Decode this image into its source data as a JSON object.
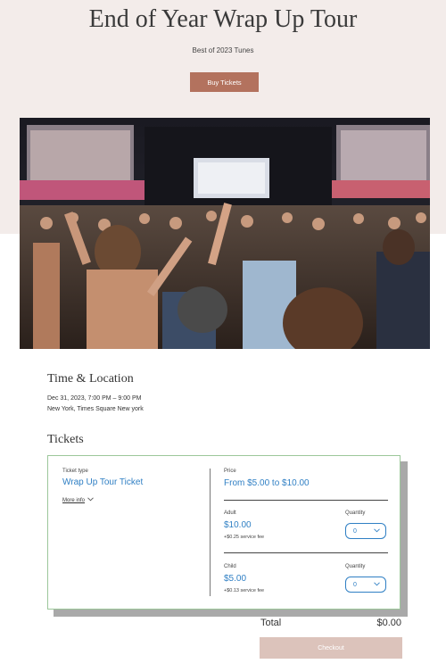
{
  "event": {
    "title": "End of Year Wrap Up Tour",
    "subtitle": "Best of 2023 Tunes",
    "buy_label": "Buy Tickets"
  },
  "time_location": {
    "heading": "Time & Location",
    "date": "Dec 31, 2023, 7:00 PM – 9:00 PM",
    "place": "New York, Times Square New york"
  },
  "tickets": {
    "heading": "Tickets",
    "ticket_type_label": "Ticket type",
    "ticket_name": "Wrap Up Tour Ticket",
    "more_info_label": "More info",
    "price_label": "Price",
    "price_range": "From $5.00 to $10.00",
    "tiers": [
      {
        "name": "Adult",
        "price": "$10.00",
        "fee": "+$0.25 service fee",
        "quantity_label": "Quantity",
        "quantity": "0"
      },
      {
        "name": "Child",
        "price": "$5.00",
        "fee": "+$0.13 service fee",
        "quantity_label": "Quantity",
        "quantity": "0"
      }
    ]
  },
  "total": {
    "label": "Total",
    "value": "$0.00"
  },
  "checkout_label": "Checkout",
  "colors": {
    "accent_button": "#b3725e",
    "link_blue": "#2f7fc4",
    "card_border": "#9cc79a",
    "hero_background": "#f3ecea",
    "checkout_disabled": "#dcc3bb"
  },
  "icons": {
    "more_info": "chevron-down-icon",
    "quantity": "chevron-down-icon"
  }
}
